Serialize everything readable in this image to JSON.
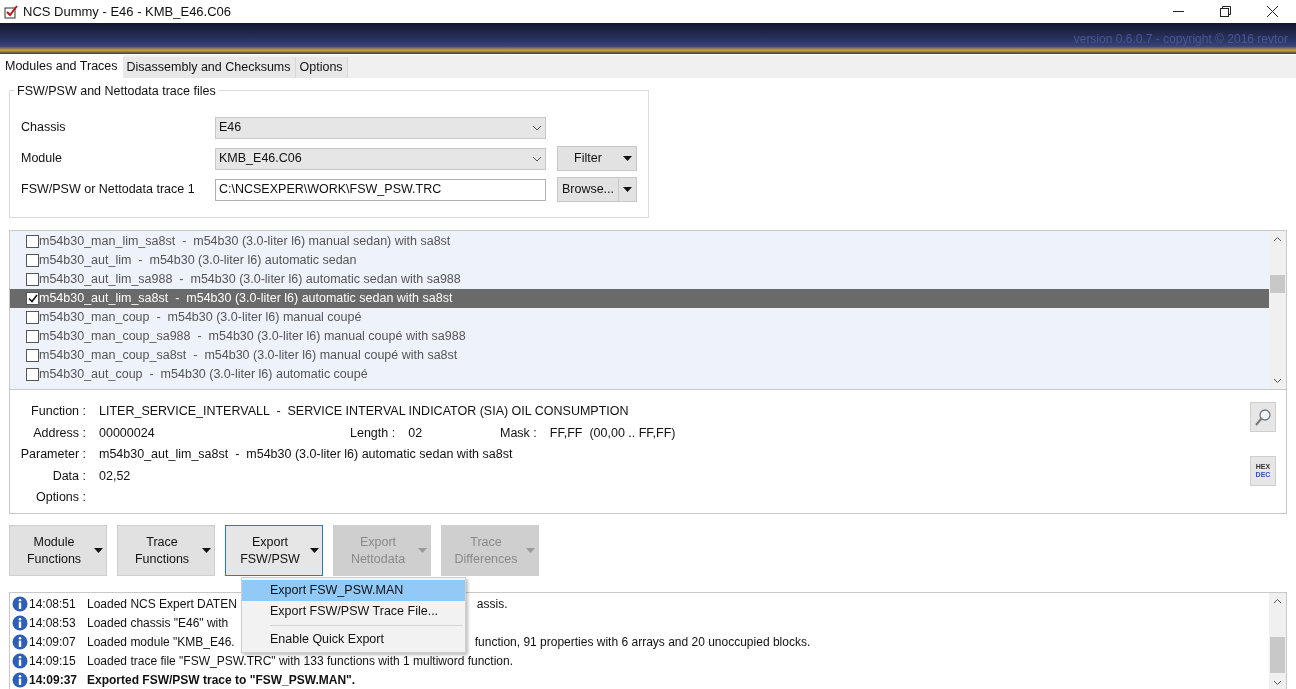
{
  "window": {
    "title": "NCS Dummy - E46 - KMB_E46.C06"
  },
  "banner": {
    "version": "version 0.6.0.7 - copyright © 2016 revtor"
  },
  "tabs": [
    {
      "label": "Modules and Traces",
      "selected": true
    },
    {
      "label": "Disassembly and Checksums",
      "selected": false
    },
    {
      "label": "Options",
      "selected": false
    }
  ],
  "group": {
    "title": "FSW/PSW and Nettodata trace files",
    "rows": [
      {
        "kind": "select",
        "label": "Chassis",
        "value": "E46"
      },
      {
        "kind": "select",
        "label": "Module",
        "value": "KMB_E46.C06",
        "button": "Filter"
      },
      {
        "kind": "text",
        "label": "FSW/PSW or Nettodata trace 1",
        "value": "C:\\NCSEXPER\\WORK\\FSW_PSW.TRC",
        "button": "Browse..."
      }
    ]
  },
  "parameters": [
    {
      "label": "m54b30_man_lim_sa8st  -  m54b30 (3.0-liter l6) manual sedan) with sa8st",
      "checked": false,
      "selected": false
    },
    {
      "label": "m54b30_aut_lim  -  m54b30 (3.0-liter l6) automatic sedan",
      "checked": false,
      "selected": false
    },
    {
      "label": "m54b30_aut_lim_sa988  -  m54b30 (3.0-liter l6) automatic sedan with sa988",
      "checked": false,
      "selected": false
    },
    {
      "label": "m54b30_aut_lim_sa8st  -  m54b30 (3.0-liter l6) automatic sedan with sa8st",
      "checked": true,
      "selected": true
    },
    {
      "label": "m54b30_man_coup  -  m54b30 (3.0-liter l6) manual coupé",
      "checked": false,
      "selected": false
    },
    {
      "label": "m54b30_man_coup_sa988  -  m54b30 (3.0-liter l6) manual coupé with sa988",
      "checked": false,
      "selected": false
    },
    {
      "label": "m54b30_man_coup_sa8st  -  m54b30 (3.0-liter l6) manual coupé with sa8st",
      "checked": false,
      "selected": false
    },
    {
      "label": "m54b30_aut_coup  -  m54b30 (3.0-liter l6) automatic coupé",
      "checked": false,
      "selected": false
    }
  ],
  "details": [
    [
      {
        "label": "Function :",
        "value": "LITER_SERVICE_INTERVALL  -  SERVICE INTERVAL INDICATOR (SIA) OIL CONSUMPTION"
      }
    ],
    [
      {
        "label": "Address :",
        "value": "00000024"
      },
      {
        "label": "Length :",
        "value": "02"
      },
      {
        "label": "Mask :",
        "value": "FF,FF  (00,00 .. FF,FF)"
      }
    ],
    [
      {
        "label": "Parameter :",
        "value": "m54b30_aut_lim_sa8st  -  m54b30 (3.0-liter l6) automatic sedan with sa8st"
      }
    ],
    [
      {
        "label": "Data :",
        "value": "02,52"
      }
    ],
    [
      {
        "label": "Options :"
      }
    ]
  ],
  "hex_dec": {
    "top": "HEX",
    "bottom": "DEC"
  },
  "actions": [
    {
      "label": "Module\nFunctions",
      "disabled": false,
      "selected": false
    },
    {
      "label": "Trace\nFunctions",
      "disabled": false,
      "selected": false
    },
    {
      "label": "Export\nFSW/PSW",
      "disabled": false,
      "selected": true
    },
    {
      "label": "Export\nNettodata",
      "disabled": true,
      "selected": false
    },
    {
      "label": "Trace\nDifferences",
      "disabled": true,
      "selected": false
    }
  ],
  "menu": [
    {
      "kind": "item",
      "label": "Export FSW_PSW.MAN",
      "selected": true
    },
    {
      "kind": "item",
      "label": "Export FSW/PSW Trace File...",
      "selected": false
    },
    {
      "kind": "separator"
    },
    {
      "kind": "item",
      "label": "Enable Quick Export",
      "selected": false
    }
  ],
  "log": [
    {
      "time": "14:08:51",
      "text": "Loaded NCS Expert DATEN",
      "after": "assis.",
      "bold": false
    },
    {
      "time": "14:08:53",
      "text": "Loaded chassis \"E46\" with",
      "bold": false
    },
    {
      "time": "14:09:07",
      "text": "Loaded module \"KMB_E46.",
      "after": "function, 91 properties with 6 arrays and 20 unoccupied blocks.",
      "bold": false
    },
    {
      "time": "14:09:15",
      "text": "Loaded trace file \"FSW_PSW.TRC\" with 133 functions with 1 multiword function.",
      "bold": false
    },
    {
      "time": "14:09:37",
      "text": "Exported FSW/PSW trace to \"FSW_PSW.MAN\".",
      "bold": true
    }
  ]
}
